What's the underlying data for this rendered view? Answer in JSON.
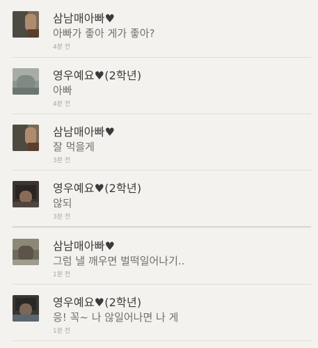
{
  "comments": [
    {
      "author": "삼남매아빠♥",
      "message": "아빠가 좋아 게가 좋아?",
      "time": "4분 전"
    },
    {
      "author": "영우예요♥(2학년)",
      "message": "아빠",
      "time": "4분 전"
    },
    {
      "author": "삼남매아빠♥",
      "message": "잘 먹을게",
      "time": "3분 전"
    },
    {
      "author": "영우예요♥(2학년)",
      "message": "않되",
      "time": "3분 전"
    },
    {
      "author": "삼남매아빠♥",
      "message": "그럼 낼 깨우면 벌떡일어나기..",
      "time": "1분 전"
    },
    {
      "author": "영우예요♥(2학년)",
      "message": "응! 꼭~ 나 않일어나면 나 게",
      "time": "1분 전"
    }
  ]
}
